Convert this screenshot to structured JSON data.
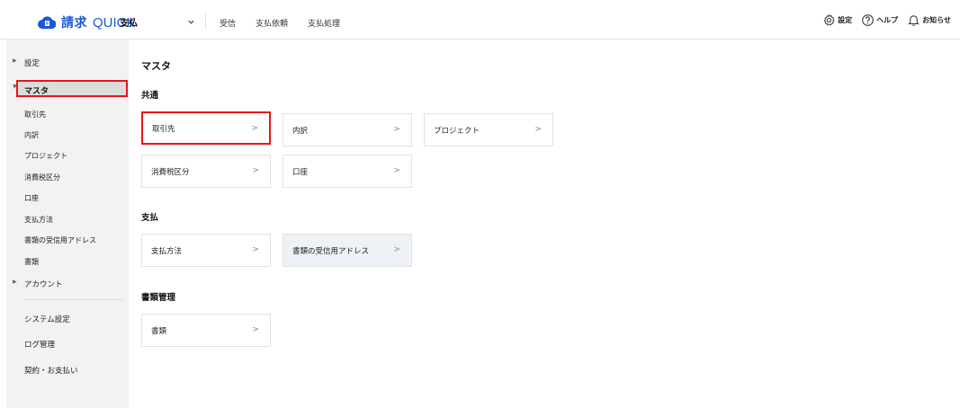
{
  "header": {
    "logo_text": "請求",
    "logo_suffix": "QUICK",
    "app_switch": "支払",
    "nav": [
      "受信",
      "支払依頼",
      "支払処理"
    ],
    "right": [
      {
        "icon": "gear-icon",
        "label": "設定"
      },
      {
        "icon": "help-icon",
        "label": "ヘルプ"
      },
      {
        "icon": "bell-icon",
        "label": "お知らせ"
      }
    ]
  },
  "sidebar": {
    "settings": "設定",
    "master": "マスタ",
    "sub_items": [
      "取引先",
      "内訳",
      "プロジェクト",
      "消費税区分",
      "口座",
      "支払方法",
      "書類の受信用アドレス",
      "書類"
    ],
    "account": "アカウント",
    "bottom": [
      "システム設定",
      "ログ管理",
      "契約・お支払い"
    ]
  },
  "main": {
    "title": "マスタ",
    "sections": [
      {
        "title": "共通",
        "cards": [
          "取引先",
          "内訳",
          "プロジェクト",
          "消費税区分",
          "口座"
        ]
      },
      {
        "title": "支払",
        "cards": [
          "支払方法",
          "書類の受信用アドレス"
        ]
      },
      {
        "title": "書類管理",
        "cards": [
          "書類"
        ]
      }
    ]
  },
  "colors": {
    "brand": "#1a58d6",
    "highlight": "#e8141a",
    "sidebar_bg": "#f2f2f2"
  }
}
